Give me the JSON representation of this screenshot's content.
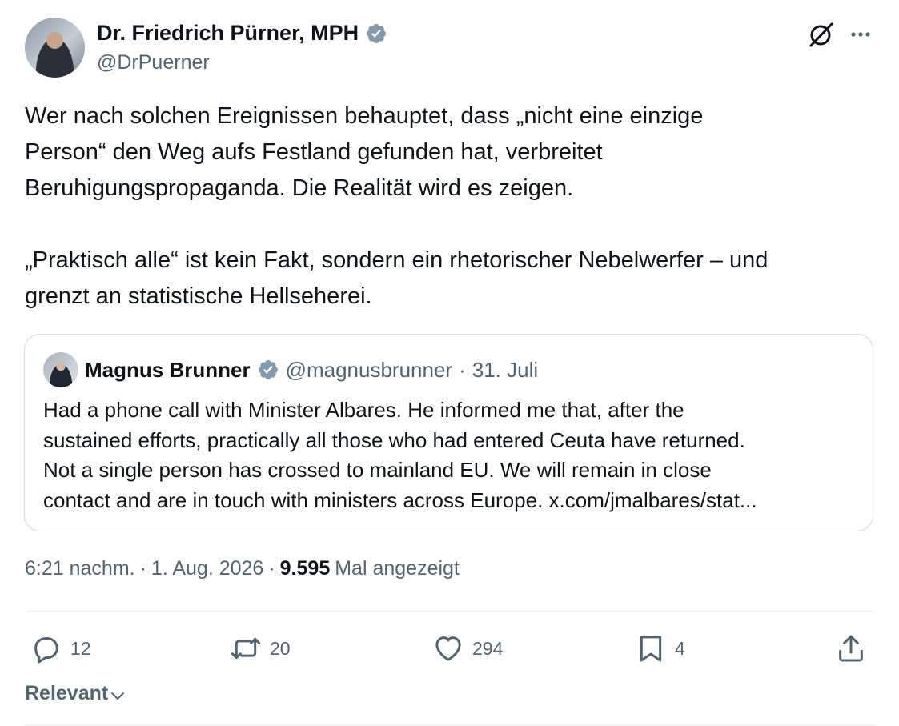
{
  "author": {
    "name": "Dr. Friedrich Pürner, MPH",
    "handle": "@DrPuerner"
  },
  "tweet": {
    "paragraph1": "Wer nach solchen Ereignissen behauptet, dass „nicht eine einzige\nPerson“ den Weg aufs Festland gefunden hat, verbreitet\nBeruhigungspropaganda. Die Realität wird es zeigen.",
    "paragraph2": "„Praktisch alle“ ist kein Fakt, sondern ein rhetorischer Nebelwerfer – und\ngrenzt an statistische Hellseherei."
  },
  "quote": {
    "name": "Magnus Brunner",
    "handle": "@magnusbrunner",
    "separator": "·",
    "date": "31. Juli",
    "text": "Had a phone call with Minister Albares. He informed me that, after the\nsustained efforts, practically all those who had entered Ceuta have returned.\nNot a single person has crossed to mainland EU. We will remain in close\ncontact and are in touch with ministers across Europe. x.com/jmalbares/stat..."
  },
  "meta": {
    "time": "6:21 nachm.",
    "sep1": "·",
    "date": "1. Aug. 2026",
    "sep2": "·",
    "views": "9.595",
    "views_label": "Mal angezeigt"
  },
  "actions": {
    "replies": "12",
    "reposts": "20",
    "likes": "294",
    "bookmarks": "4"
  },
  "sort": {
    "label": "Relevant"
  },
  "icons": {
    "verified": "verified-badge-icon",
    "grok": "grok-icon",
    "more": "more-icon",
    "reply": "reply-icon",
    "repost": "repost-icon",
    "like": "like-icon",
    "bookmark": "bookmark-icon",
    "share": "share-icon",
    "chevron": "chevron-down-icon"
  },
  "colors": {
    "verified": "#829aab",
    "text": "#0f1419",
    "secondary": "#536471",
    "border": "#cfd9de"
  }
}
